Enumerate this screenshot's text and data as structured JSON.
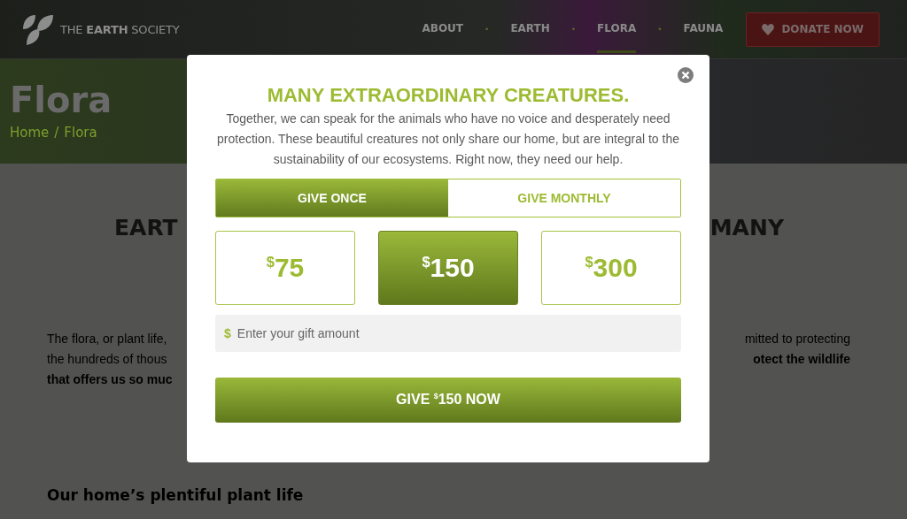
{
  "header": {
    "logo": "THE **EARTH** SOCIETY",
    "nav_separator": "•",
    "nav": [
      {
        "label": "ABOUT",
        "selected": false
      },
      {
        "label": "EARTH",
        "selected": false
      },
      {
        "label": "FLORA",
        "selected": true
      },
      {
        "label": "FAUNA",
        "selected": false
      }
    ],
    "donate_button": "DONATE NOW"
  },
  "hero": {
    "title": "Flora",
    "breadcrumb": {
      "separator": "/",
      "items": [
        "Home",
        "Flora"
      ]
    }
  },
  "content": {
    "heading_left": "EART",
    "heading_right": "MANY",
    "paragraph_left": [
      {
        "text": "The flora, or plant life,",
        "bold": false
      },
      {
        "text": "the hundreds of thous",
        "bold": false
      },
      {
        "text": "that offers us so muc",
        "bold": true
      }
    ],
    "paragraph_right": [
      {
        "text": "mitted to protecting",
        "bold": false
      },
      {
        "text": "otect the wildlife",
        "bold": true
      }
    ],
    "subheading": "Our home’s plentiful plant life"
  },
  "modal": {
    "title": "MANY EXTRAORDINARY CREATURES.",
    "text": "Together, we can speak for the animals who have no voice and desperately need protection. These beautiful creatures not only share our home, but are integral to the sustainability of our ecosystems. Right now, they need our help.",
    "frequency": [
      {
        "label": "GIVE ONCE",
        "selected": true
      },
      {
        "label": "GIVE MONTHLY",
        "selected": false
      }
    ],
    "amounts": [
      {
        "currency": "$",
        "value": "75",
        "selected": false
      },
      {
        "currency": "$",
        "value": "150",
        "selected": true
      },
      {
        "currency": "$",
        "value": "300",
        "selected": false
      }
    ],
    "input": {
      "currency": "$",
      "placeholder": "Enter your gift amount"
    },
    "submit": {
      "prefix": "GIVE",
      "currency": "$",
      "amount": "150",
      "suffix": "NOW"
    }
  }
}
